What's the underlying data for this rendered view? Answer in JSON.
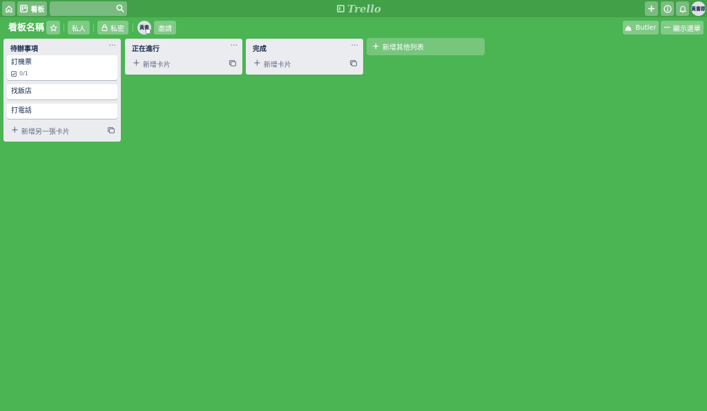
{
  "colors": {
    "board_background": "#4bb453",
    "header_background": "#41a048",
    "list_background": "#ebecf0",
    "card_background": "#ffffff"
  },
  "header": {
    "home_icon": "home-icon",
    "boards_label": "看板",
    "search": {
      "value": "",
      "placeholder": ""
    },
    "logo_text": "Trello",
    "avatar_text": "黃書郡"
  },
  "board": {
    "title": "看板名稱",
    "visibility_team": "私人",
    "visibility_private": "私密",
    "member_avatar_text": "黃書",
    "invite_label": "邀請",
    "butler_label": "Butler",
    "menu_label": "顯示選單"
  },
  "lists": [
    {
      "title": "待辦事項",
      "cards": [
        {
          "title": "訂機票",
          "checklist": "0/1"
        },
        {
          "title": "找飯店"
        },
        {
          "title": "打電話"
        }
      ],
      "add_card_label": "新增另一張卡片"
    },
    {
      "title": "正在進行",
      "cards": [],
      "add_card_label": "新增卡片"
    },
    {
      "title": "完成",
      "cards": [],
      "add_card_label": "新增卡片"
    }
  ],
  "add_list_label": "新增其他列表"
}
